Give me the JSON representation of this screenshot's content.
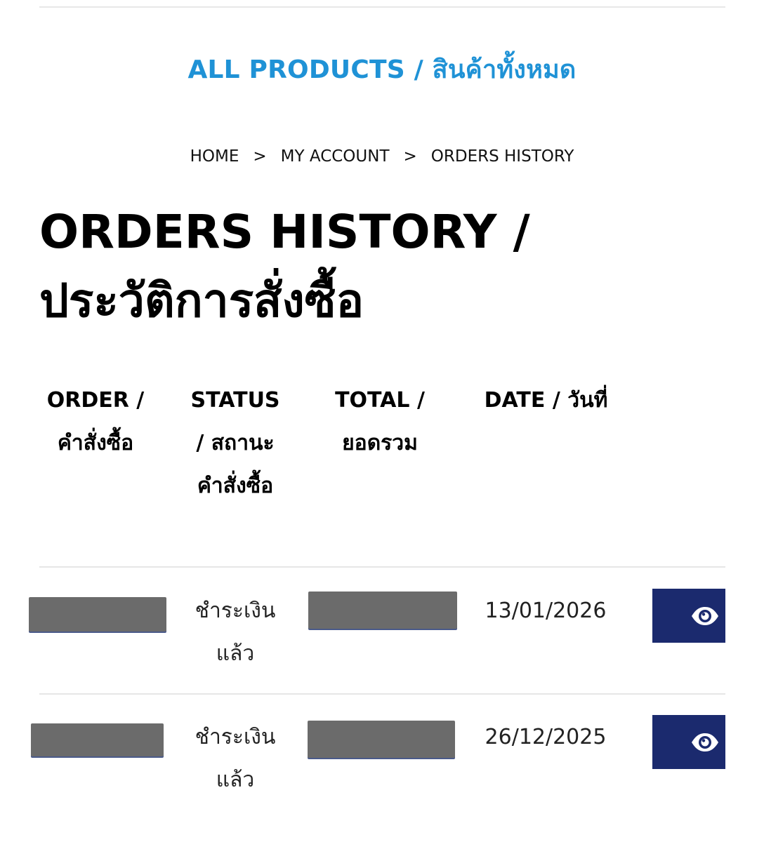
{
  "header": {
    "all_products_label": "ALL PRODUCTS / สินค้าทั้งหมด"
  },
  "breadcrumb": {
    "items": [
      "HOME",
      "MY ACCOUNT",
      "ORDERS HISTORY"
    ],
    "separator": ">"
  },
  "page": {
    "title": "ORDERS HISTORY / ประวัติการสั่งซื้อ"
  },
  "table": {
    "columns": [
      "ORDER / คำสั่งซื้อ",
      "STATUS / สถานะคำสั่งซื้อ",
      "TOTAL / ยอดรวม",
      "DATE / วันที่"
    ],
    "rows": [
      {
        "order": "",
        "status": "ชำระเงินแล้ว",
        "total": "",
        "date": "13/01/2026",
        "action_icon": "eye-icon"
      },
      {
        "order": "",
        "status": "ชำระเงินแล้ว",
        "total": "",
        "date": "26/12/2025",
        "action_icon": "eye-icon"
      }
    ]
  },
  "colors": {
    "accent_blue": "#1f92d6",
    "button_navy": "#1b2a6e",
    "redaction_gray": "#6b6b6b"
  }
}
